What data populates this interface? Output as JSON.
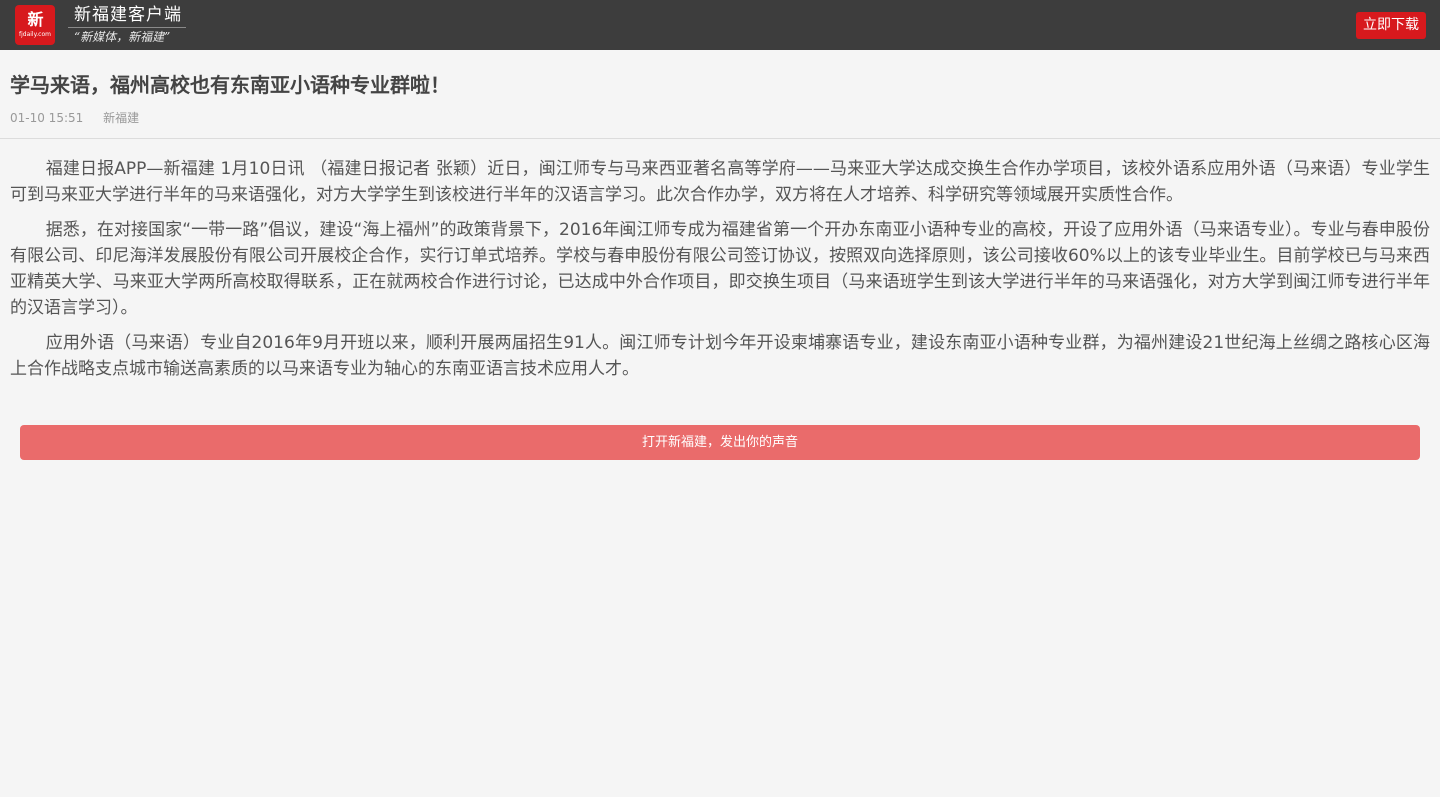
{
  "header": {
    "logo_glyph": "新",
    "logo_domain": "fjdaily.com",
    "brand_name": "新福建客户端",
    "brand_slogan": "“新媒体，新福建”",
    "download_label": "立即下载"
  },
  "article": {
    "title": "学马来语，福州高校也有东南亚小语种专业群啦！",
    "date": "01-10 15:51",
    "source": "新福建",
    "paragraphs": [
      "福建日报APP—新福建 1月10日讯 （福建日报记者 张颖）近日，闽江师专与马来西亚著名高等学府——马来亚大学达成交换生合作办学项目，该校外语系应用外语（马来语）专业学生可到马来亚大学进行半年的马来语强化，对方大学学生到该校进行半年的汉语言学习。此次合作办学，双方将在人才培养、科学研究等领域展开实质性合作。",
      "据悉，在对接国家“一带一路”倡议，建设“海上福州”的政策背景下，2016年闽江师专成为福建省第一个开办东南亚小语种专业的高校，开设了应用外语（马来语专业）。专业与春申股份有限公司、印尼海洋发展股份有限公司开展校企合作，实行订单式培养。学校与春申股份有限公司签订协议，按照双向选择原则，该公司接收60%以上的该专业毕业生。目前学校已与马来西亚精英大学、马来亚大学两所高校取得联系，正在就两校合作进行讨论，已达成中外合作项目，即交换生项目（马来语班学生到该大学进行半年的马来语强化，对方大学到闽江师专进行半年的汉语言学习）。",
      "应用外语（马来语）专业自2016年9月开班以来，顺利开展两届招生91人。闽江师专计划今年开设柬埔寨语专业，建设东南亚小语种专业群，为福州建设21世纪海上丝绸之路核心区海上合作战略支点城市输送高素质的以马来语专业为轴心的东南亚语言技术应用人才。"
    ]
  },
  "cta": {
    "label": "打开新福建，发出你的声音"
  },
  "colors": {
    "topbar": "#3d3d3d",
    "brand_red": "#d7191d",
    "cta": "#ea6b6b",
    "page_bg": "#f5f5f5"
  }
}
